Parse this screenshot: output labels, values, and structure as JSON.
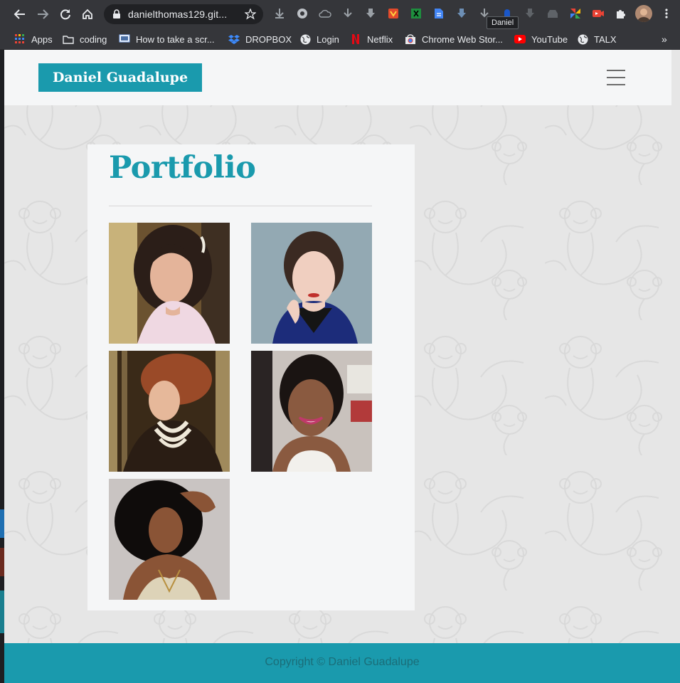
{
  "browser": {
    "url": "danielthomas129.git...",
    "tooltip": "Daniel",
    "bookmarks": [
      {
        "label": "Apps",
        "icon": "apps-grid-icon"
      },
      {
        "label": "coding",
        "icon": "folder-icon"
      },
      {
        "label": "How to take a scr...",
        "icon": "page-icon"
      },
      {
        "label": "DROPBOX",
        "icon": "dropbox-icon"
      },
      {
        "label": "Login",
        "icon": "globe-icon"
      },
      {
        "label": "Netflix",
        "icon": "netflix-icon"
      },
      {
        "label": "Chrome Web Stor...",
        "icon": "webstore-icon"
      },
      {
        "label": "YouTube",
        "icon": "youtube-icon"
      },
      {
        "label": "TALX",
        "icon": "globe-icon"
      }
    ],
    "more": "»"
  },
  "site": {
    "brand": "Daniel Guadalupe",
    "portfolio_title": "Portfolio",
    "footer": "Copyright © Daniel Guadalupe",
    "accent": "#1a9aad",
    "portfolio_images": [
      {
        "name": "portrait-bride"
      },
      {
        "name": "portrait-blue-top"
      },
      {
        "name": "portrait-pearls"
      },
      {
        "name": "portrait-smile"
      },
      {
        "name": "portrait-curls"
      }
    ]
  }
}
